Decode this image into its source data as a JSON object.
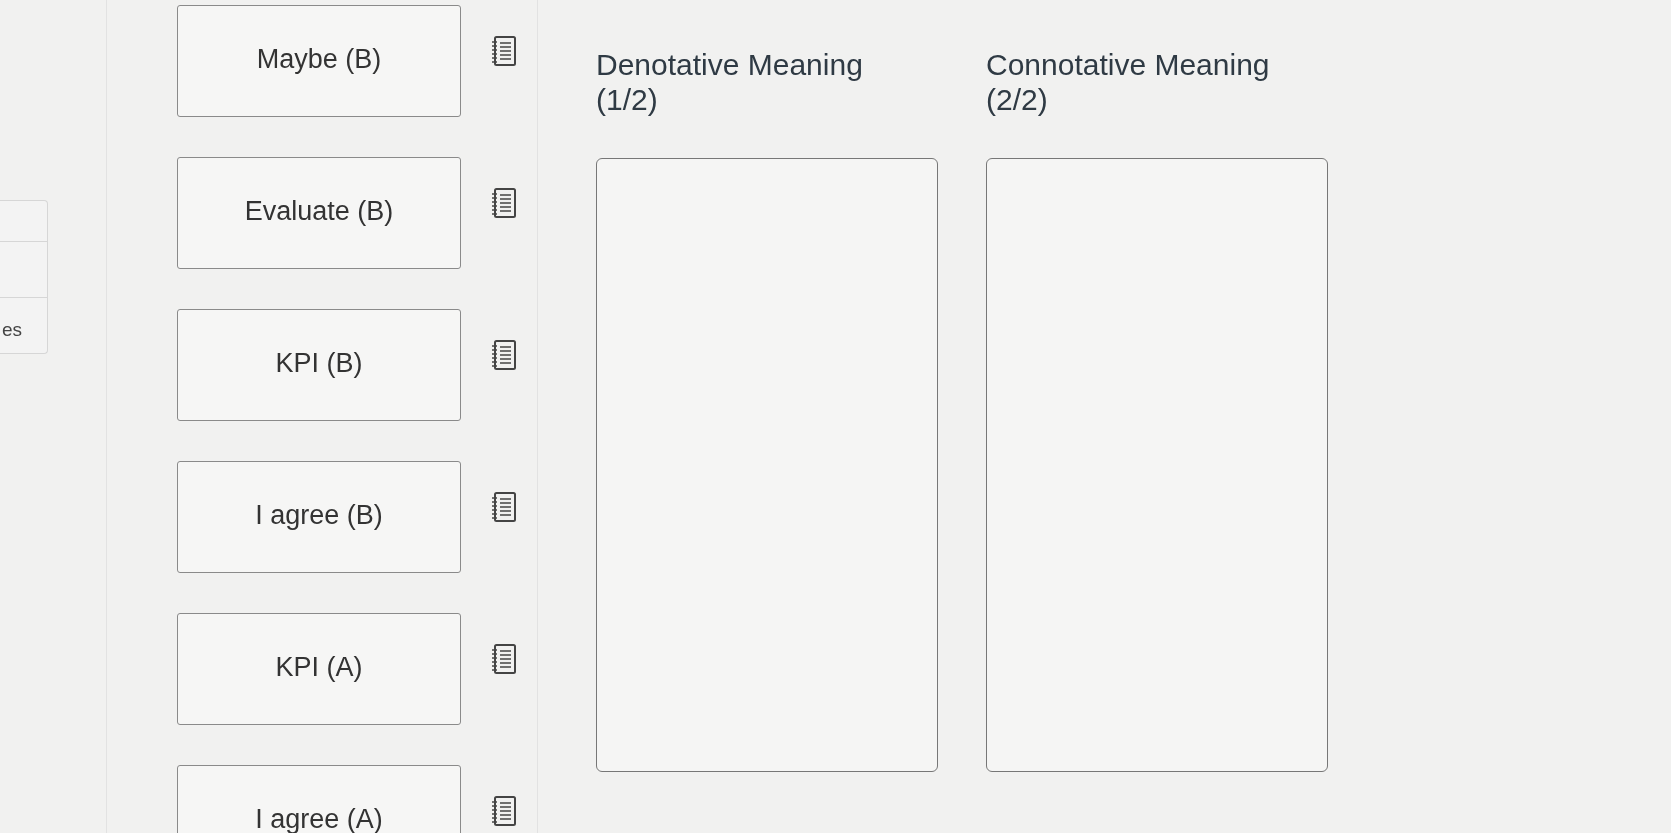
{
  "side_panel": {
    "label": "es"
  },
  "cards": [
    {
      "label": "Maybe (B)"
    },
    {
      "label": "Evaluate (B)"
    },
    {
      "label": "KPI (B)"
    },
    {
      "label": "I agree (B)"
    },
    {
      "label": "KPI (A)"
    },
    {
      "label": "I agree (A)"
    }
  ],
  "targets": [
    {
      "title": "Denotative Meaning (1/2)"
    },
    {
      "title": "Connotative Meaning (2/2)"
    }
  ]
}
